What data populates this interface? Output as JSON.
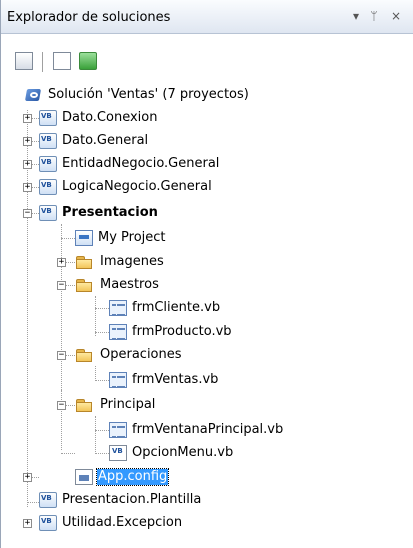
{
  "window": {
    "title": "Explorador de soluciones",
    "dropdown_icon": "▾",
    "pin_icon": "ᛘ",
    "close_icon": "×"
  },
  "toolbar": {
    "buttons": [
      {
        "name": "properties-icon"
      },
      {
        "name": "show-all-files-icon"
      },
      {
        "name": "refresh-icon"
      }
    ]
  },
  "tree": {
    "solution": "Solución 'Ventas'  (7 proyectos)",
    "projects": [
      {
        "label": "Dato.Conexion"
      },
      {
        "label": "Dato.General"
      },
      {
        "label": "EntidadNegocio.General"
      },
      {
        "label": "LogicaNegocio.General"
      },
      {
        "label": "Presentacion"
      },
      {
        "label": "Presentacion.Plantilla"
      },
      {
        "label": "Utilidad.Excepcion"
      }
    ],
    "presentacion_children": {
      "my_project": "My Project",
      "imagenes": "Imagenes",
      "maestros": "Maestros",
      "frm_cliente": "frmCliente.vb",
      "frm_producto": "frmProducto.vb",
      "operaciones": "Operaciones",
      "frm_ventas": "frmVentas.vb",
      "principal": "Principal",
      "frm_ventana_principal": "frmVentanaPrincipal.vb",
      "opcion_menu": "OpcionMenu.vb",
      "app_config": "App.config"
    },
    "expand_symbol": "+",
    "collapse_symbol": "−"
  },
  "colors": {
    "selection": "#3399ff",
    "titlebar_top": "#fafcfe",
    "titlebar_bottom": "#dfe6f1"
  }
}
